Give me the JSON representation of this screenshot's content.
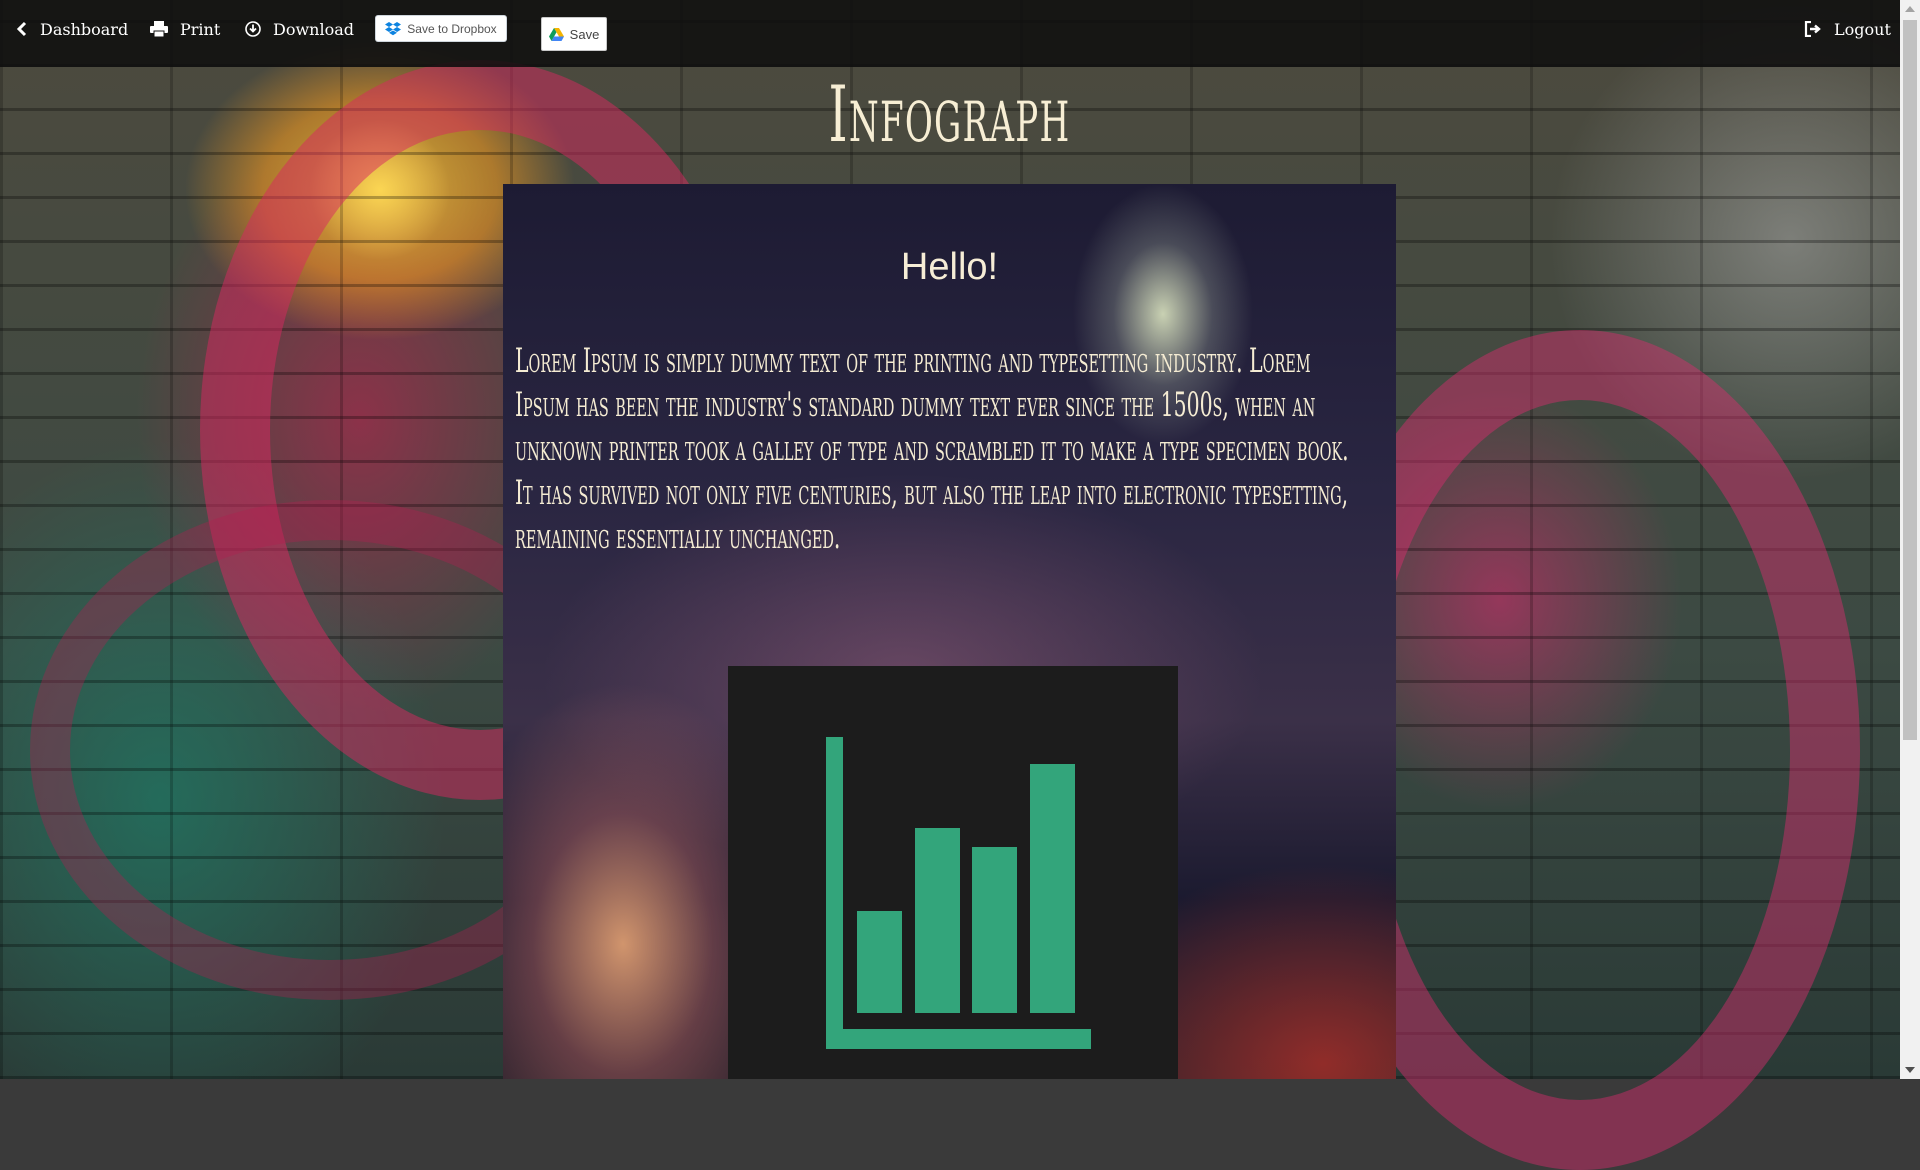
{
  "nav": {
    "dashboard": "Dashboard",
    "print": "Print",
    "download": "Download",
    "dropbox": "Save to Dropbox",
    "drive_save": "Save",
    "logout": "Logout"
  },
  "page": {
    "title": "Infograph"
  },
  "card": {
    "heading": "Hello!",
    "body": "Lorem Ipsum is simply dummy text of the printing and typesetting industry. Lorem Ipsum has been the industry's standard dummy text ever since the 1500s, when an unknown printer took a galley of type and scrambled it to make a type specimen book. It has survived not only five centuries, but also the leap into electronic typesetting, remaining essentially unchanged."
  },
  "icons": {
    "chart": "bar-chart-icon"
  },
  "colors": {
    "accent": "#33a57b",
    "topbar": "#0f0f0f",
    "text_cream": "#f5ecd3"
  }
}
